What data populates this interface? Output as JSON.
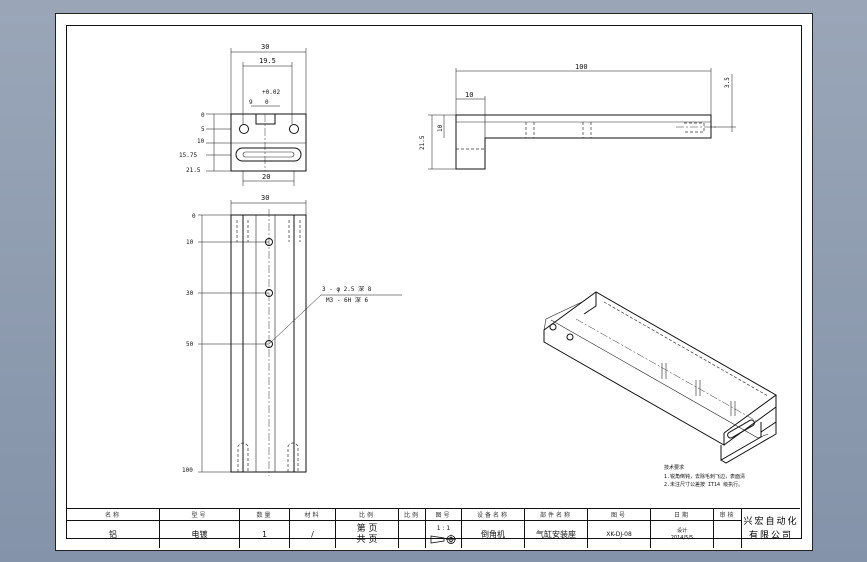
{
  "drawing": {
    "front_view": {
      "width_dims": [
        "30",
        "19.5"
      ],
      "tolerance": "+0.02",
      "slot_dims": [
        "9",
        "0"
      ],
      "left_dims": [
        "0",
        "5",
        "10",
        "15.75",
        "21.5"
      ],
      "bottom_dim": "20"
    },
    "side_view": {
      "length_dim": "100",
      "step_dim": "10",
      "height_dims": [
        "21.5",
        "10"
      ],
      "right_dim": "3.5"
    },
    "top_view": {
      "width_dim": "30",
      "left_dims": [
        "0",
        "10",
        "30",
        "50",
        "100"
      ],
      "hole_note_line1": "3 - φ 2.5 深 8",
      "hole_note_line2": "M3 - 6H 深 6"
    },
    "notes": {
      "title": "技术要求",
      "line1": "1.锐角倒钝，去除毛刺飞边，表面清",
      "line2": "2.未注尺寸公差按 IT14 级执行。"
    }
  },
  "title_block": {
    "headers": [
      "名称",
      "型号",
      "数量",
      "材料",
      "比例",
      "比例",
      "图号",
      "设备名称",
      "部件名称",
      "图号",
      "日期",
      "审核"
    ],
    "values": [
      "铝",
      "电镀",
      "1",
      "/",
      "",
      "",
      "",
      "倒角机",
      "气缸安装座",
      "XK-DJ-08",
      "",
      ""
    ],
    "page_info": [
      "第  页",
      "共  页"
    ],
    "scale": "1 : 1",
    "date_label": "设计",
    "date_value": "2014/5/5",
    "company_line1": "兴宏自动化",
    "company_line2": "有限公司"
  }
}
